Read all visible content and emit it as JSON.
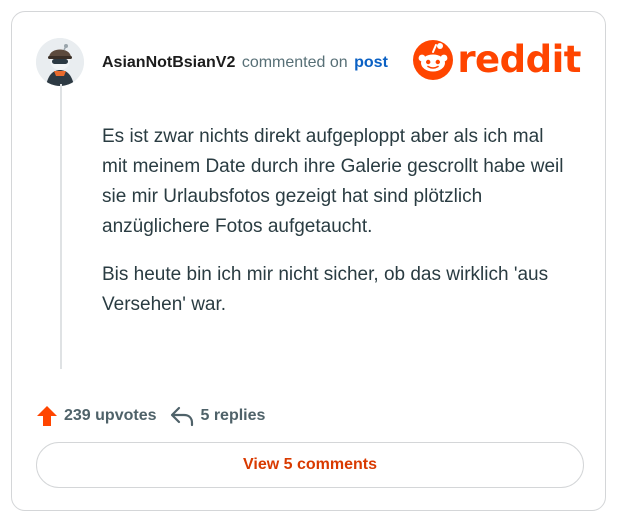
{
  "comment": {
    "username": "AsianNotBsianV2",
    "action_text": "commented on",
    "post_link": "post",
    "paragraphs": [
      "Es ist zwar nichts direkt aufgeploppt aber als ich mal mit meinem Date durch ihre Galerie gescrollt habe weil sie mir Urlaubsfotos gezeigt hat sind plötzlich anzüglichere Fotos aufgetaucht.",
      "Bis heute bin ich mir nicht sicher, ob das wirklich 'aus Versehen' war."
    ]
  },
  "brand": {
    "wordmark": "reddit",
    "color": "#ff4500"
  },
  "stats": {
    "upvotes_label": "239 upvotes",
    "replies_label": "5 replies",
    "upvote_icon": "upvote-arrow-icon",
    "reply_icon": "reply-arrow-icon"
  },
  "actions": {
    "view_comments_label": "View 5 comments"
  },
  "colors": {
    "accent": "#d93a00",
    "link": "#0b61c4",
    "upvote": "#ff4500"
  }
}
